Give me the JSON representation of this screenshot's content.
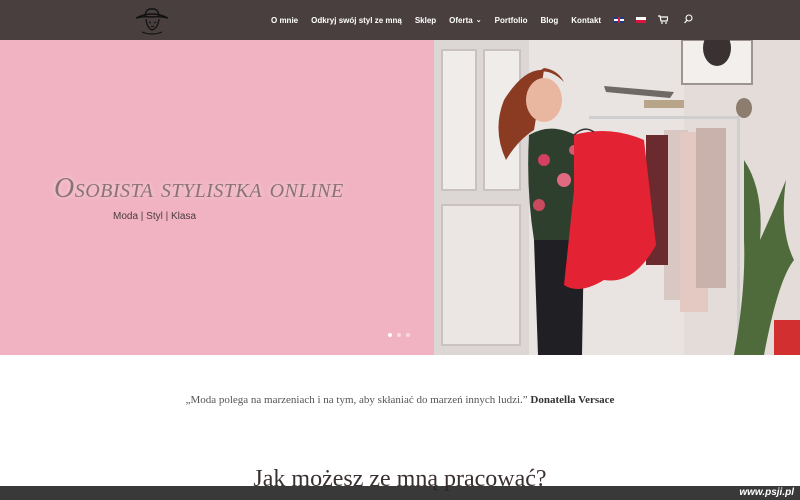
{
  "nav": {
    "items": [
      {
        "label": "O mnie"
      },
      {
        "label": "Odkryj swój styl ze mną"
      },
      {
        "label": "Sklep"
      },
      {
        "label": "Oferta",
        "has_dropdown": true
      },
      {
        "label": "Portfolio"
      },
      {
        "label": "Blog"
      },
      {
        "label": "Kontakt"
      }
    ],
    "icons": [
      "uk-flag-icon",
      "pl-flag-icon",
      "cart-icon",
      "search-icon"
    ]
  },
  "hero": {
    "title": "Osobista stylistka online",
    "subtitle": "Moda | Styl | Klasa",
    "background": "#f1b3c1",
    "active_slide": 1,
    "slide_count": 3
  },
  "quote": {
    "text": "„Moda polega na marzeniach i na tym, aby skłaniać do marzeń innych ludzi.”",
    "author": "Donatella Versace"
  },
  "section": {
    "title": "Jak możesz ze mną pracować?"
  },
  "watermark": "www.psji.pl"
}
